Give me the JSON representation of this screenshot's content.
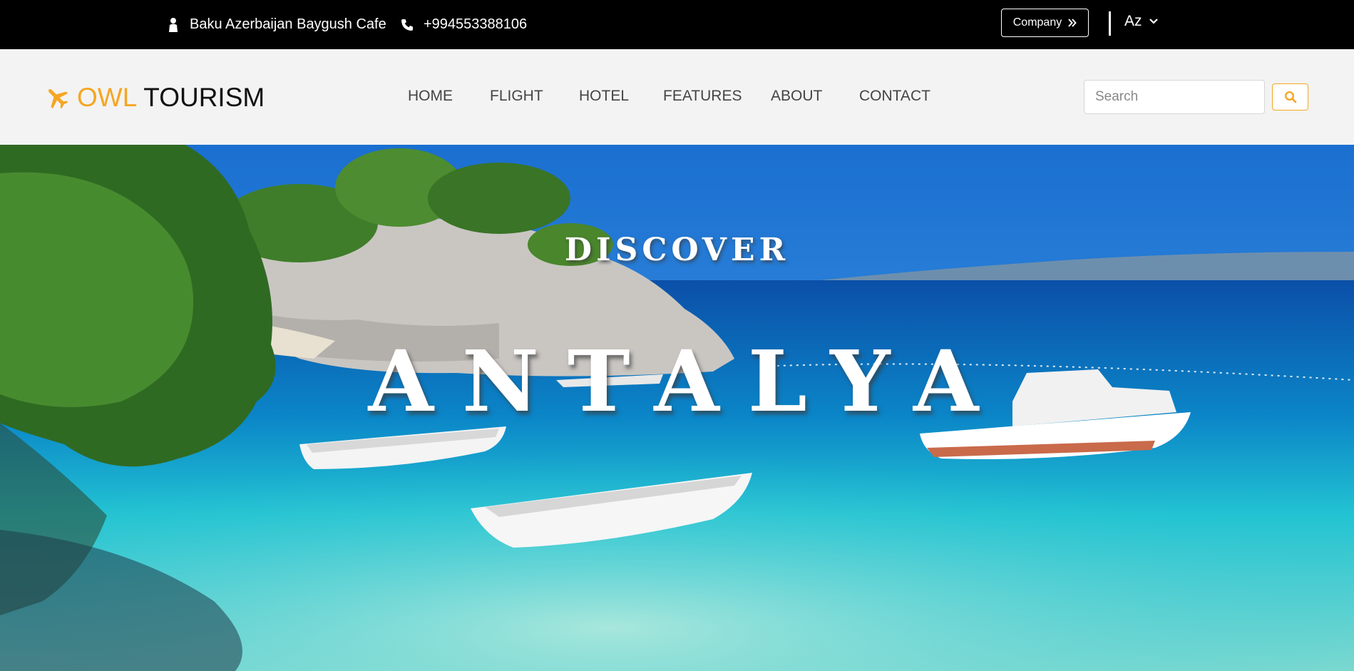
{
  "topbar": {
    "location": "Baku Azerbaijan Baygush Cafe",
    "phone": "+994553388106",
    "company_label": "Company",
    "language": "Az"
  },
  "header": {
    "logo_owl": "OWL",
    "logo_tourism": "TOURISM",
    "nav": [
      "HOME",
      "FLIGHT",
      "HOTEL",
      "FEATURES",
      "ABOUT",
      "CONTACT"
    ],
    "search_placeholder": "Search"
  },
  "hero": {
    "kicker": "DISCOVER",
    "title": "ANTALYA"
  },
  "colors": {
    "accent": "#f5a623",
    "topbar_bg": "#000000",
    "header_bg": "#f3f3f3"
  },
  "icons": [
    "person-icon",
    "phone-icon",
    "double-chevron-right-icon",
    "chevron-down-icon",
    "airplane-icon",
    "search-icon"
  ]
}
